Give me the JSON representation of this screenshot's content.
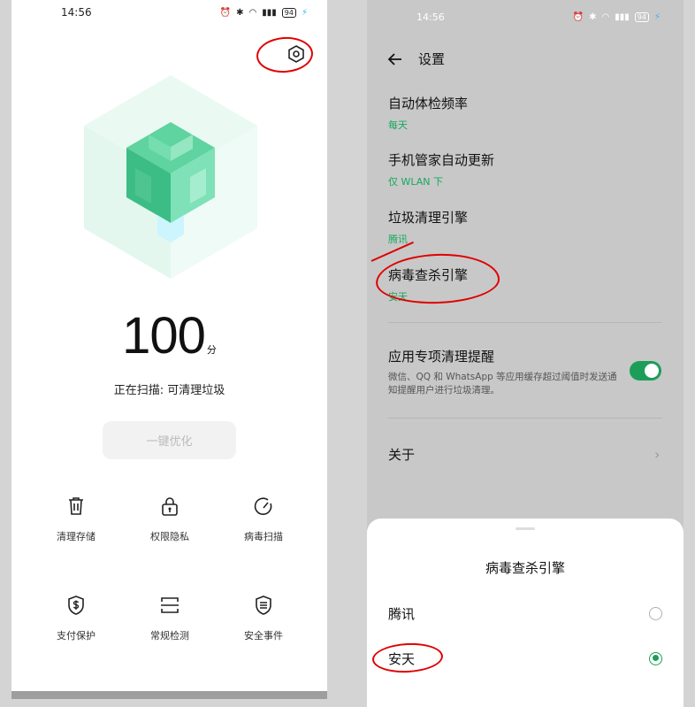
{
  "left_screen": {
    "status_bar": {
      "time": "14:56",
      "battery": "94"
    },
    "score": {
      "value": "100",
      "unit": "分"
    },
    "scan_status": "正在扫描: 可清理垃圾",
    "optimize_button": "一键优化",
    "tools": [
      {
        "label": "清理存储",
        "icon": "trash-icon"
      },
      {
        "label": "权限隐私",
        "icon": "lock-icon"
      },
      {
        "label": "病毒扫描",
        "icon": "gauge-icon"
      },
      {
        "label": "支付保护",
        "icon": "dollar-shield-icon"
      },
      {
        "label": "常规检测",
        "icon": "scan-icon"
      },
      {
        "label": "安全事件",
        "icon": "shield-list-icon"
      }
    ],
    "colors": {
      "accent": "#1c9e58",
      "annotation": "#e00000"
    }
  },
  "right_screen": {
    "status_bar": {
      "time": "14:56",
      "battery": "94"
    },
    "title": "设置",
    "settings": [
      {
        "title": "自动体检频率",
        "value": "每天"
      },
      {
        "title": "手机管家自动更新",
        "value": "仅 WLAN 下"
      },
      {
        "title": "垃圾清理引擎",
        "value": "腾讯"
      },
      {
        "title": "病毒查杀引擎",
        "value": "安天"
      }
    ],
    "reminder": {
      "title": "应用专项清理提醒",
      "description": "微信、QQ 和 WhatsApp 等应用缓存超过阈值时发送通知提醒用户进行垃圾清理。",
      "enabled": true
    },
    "about": "关于",
    "sheet": {
      "title": "病毒查杀引擎",
      "options": [
        {
          "label": "腾讯",
          "selected": false
        },
        {
          "label": "安天",
          "selected": true
        }
      ]
    }
  }
}
